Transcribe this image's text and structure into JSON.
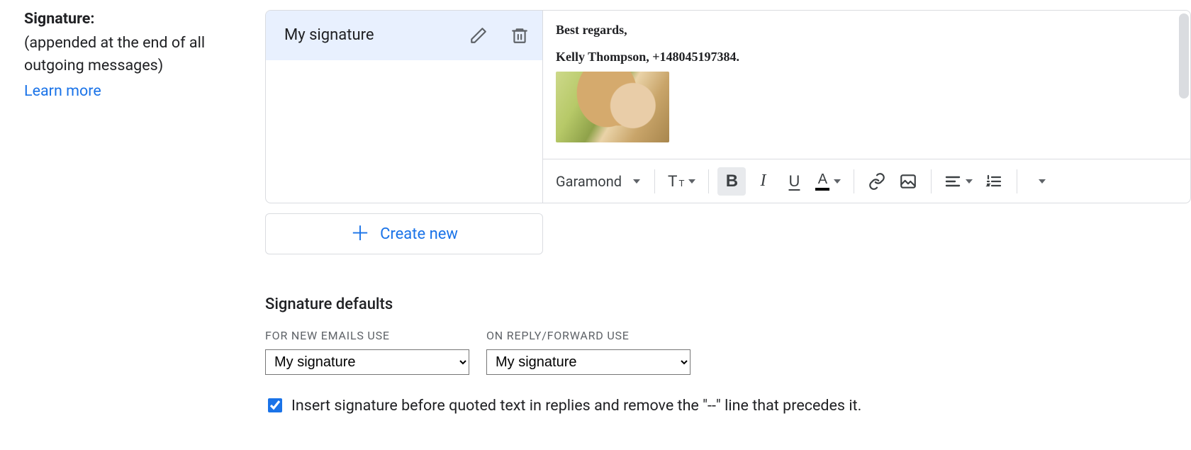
{
  "left": {
    "title": "Signature:",
    "desc": "(appended at the end of all outgoing messages)",
    "learn_more": "Learn more"
  },
  "signatures": {
    "items": [
      {
        "name": "My signature"
      }
    ]
  },
  "editor": {
    "greeting": "Best regards,",
    "name_line": "Kelly Thompson, +148045197384.",
    "font_name": "Garamond"
  },
  "create_new_label": "Create new",
  "defaults": {
    "heading": "Signature defaults",
    "new_label": "FOR NEW EMAILS USE",
    "reply_label": "ON REPLY/FORWARD USE",
    "new_value": "My signature",
    "reply_value": "My signature",
    "options": [
      "My signature"
    ]
  },
  "checkbox": {
    "checked": true,
    "label": "Insert signature before quoted text in replies and remove the \"--\" line that precedes it."
  },
  "icons": {
    "edit": "pencil-icon",
    "delete": "trash-icon",
    "font_caret": "caret-down-icon",
    "size": "text-size-icon",
    "bold": "bold-icon",
    "italic": "italic-icon",
    "underline": "underline-icon",
    "textcolor": "text-color-icon",
    "link": "link-icon",
    "image": "image-icon",
    "align": "align-icon",
    "list": "numbered-list-icon",
    "more": "more-caret-icon",
    "plus": "plus-icon"
  }
}
